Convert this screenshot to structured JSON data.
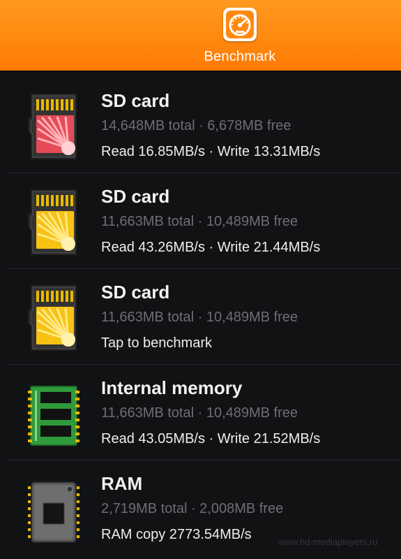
{
  "header": {
    "tab_label": "Benchmark",
    "tab_icon": "speedometer-icon",
    "colors": {
      "bar": "#ff7a05",
      "bar_top": "#ff9a1e"
    }
  },
  "items": [
    {
      "title": "SD card",
      "subtitle": "14,648MB total · 6,678MB free",
      "detail": "Read 16.85MB/s · Write 13.31MB/s",
      "icon": "sd-card-red-icon"
    },
    {
      "title": "SD card",
      "subtitle": "11,663MB total · 10,489MB free",
      "detail": "Read 43.26MB/s · Write 21.44MB/s",
      "icon": "sd-card-yellow-icon"
    },
    {
      "title": "SD card",
      "subtitle": "11,663MB total · 10,489MB free",
      "detail": "Tap to benchmark",
      "icon": "sd-card-yellow-icon"
    },
    {
      "title": "Internal memory",
      "subtitle": "11,663MB total · 10,489MB free",
      "detail": "Read 43.05MB/s · Write 21.52MB/s",
      "icon": "memory-chip-icon"
    },
    {
      "title": "RAM",
      "subtitle": "2,719MB total · 2,008MB free",
      "detail": "RAM copy 2773.54MB/s",
      "icon": "ram-chip-icon"
    }
  ],
  "watermark": "www.hd-mediaplayers.ru"
}
